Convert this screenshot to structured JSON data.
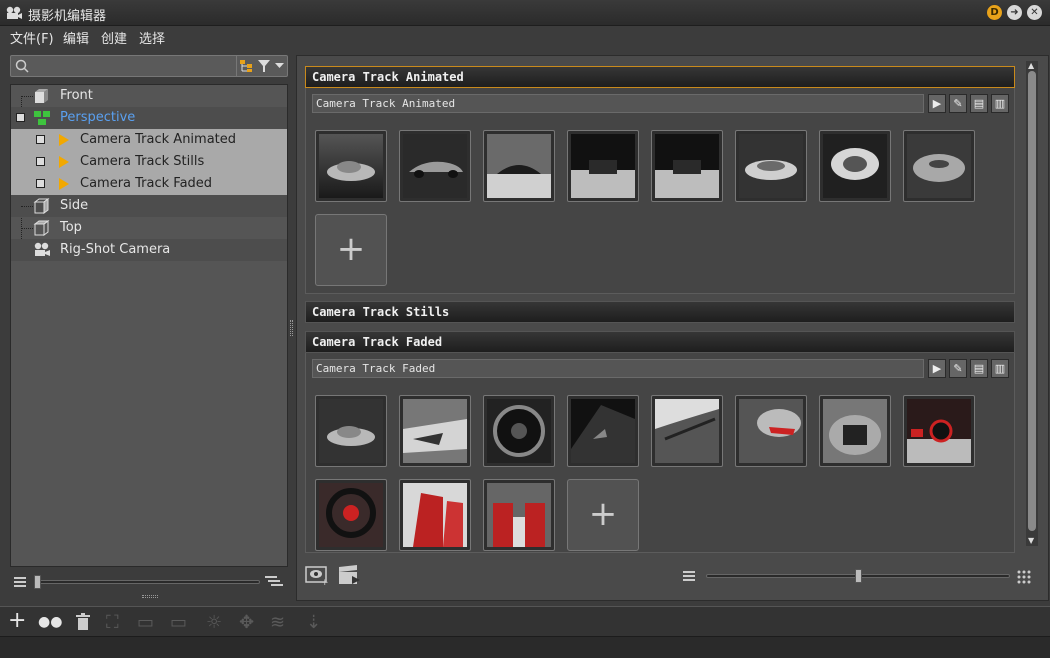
{
  "window": {
    "title": "摄影机编辑器"
  },
  "menu": {
    "items": [
      "文件(F)",
      "编辑",
      "创建",
      "选择"
    ]
  },
  "search": {
    "placeholder": "",
    "value": ""
  },
  "tree": {
    "items": [
      {
        "label": "Front",
        "icon": "cube-view-icon"
      },
      {
        "label": "Perspective",
        "icon": "perspective-group-icon",
        "selected": true
      },
      {
        "label": "Camera Track Animated",
        "icon": "camera-track-icon"
      },
      {
        "label": "Camera Track Stills",
        "icon": "camera-track-icon"
      },
      {
        "label": "Camera Track Faded",
        "icon": "camera-track-icon"
      },
      {
        "label": "Side",
        "icon": "cube-view-icon"
      },
      {
        "label": "Top",
        "icon": "cube-view-icon"
      },
      {
        "label": "Rig-Shot Camera",
        "icon": "rig-camera-icon"
      }
    ]
  },
  "left_slider": {
    "level": 0.0
  },
  "sections": [
    {
      "title": "Camera Track Animated",
      "track_name": "Camera Track Animated",
      "expanded": true,
      "thumbnails": 8
    },
    {
      "title": "Camera Track Stills",
      "expanded": false
    },
    {
      "title": "Camera Track Faded",
      "track_name": "Camera Track Faded",
      "expanded": true,
      "thumbnails": 11
    }
  ],
  "add_symbol": "+",
  "zoom_slider": {
    "level": 0.5
  },
  "colors": {
    "accent": "#c98a1c",
    "selected_text": "#5aa0f0",
    "d_badge": "#e8a21a"
  }
}
